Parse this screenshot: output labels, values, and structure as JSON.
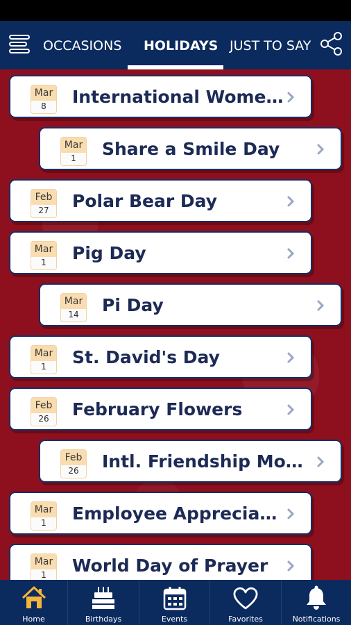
{
  "top_nav": {
    "tabs": [
      {
        "label": "OCCASIONS",
        "active": false
      },
      {
        "label": "HOLIDAYS",
        "active": true
      },
      {
        "label": "JUST TO SAY",
        "active": false
      }
    ],
    "menu_icon": "hamburger-menu-icon",
    "share_icon": "share-icon"
  },
  "holidays": [
    {
      "month": "Mar",
      "day": "8",
      "title": "International Women...",
      "level": "outer"
    },
    {
      "month": "Mar",
      "day": "1",
      "title": "Share a Smile Day",
      "level": "inner"
    },
    {
      "month": "Feb",
      "day": "27",
      "title": "Polar Bear Day",
      "level": "outer"
    },
    {
      "month": "Mar",
      "day": "1",
      "title": "Pig Day",
      "level": "outer"
    },
    {
      "month": "Mar",
      "day": "14",
      "title": "Pi Day",
      "level": "inner"
    },
    {
      "month": "Mar",
      "day": "1",
      "title": "St. David's Day",
      "level": "outer"
    },
    {
      "month": "Feb",
      "day": "26",
      "title": "February Flowers",
      "level": "outer"
    },
    {
      "month": "Feb",
      "day": "26",
      "title": "Intl. Friendship Month",
      "level": "inner"
    },
    {
      "month": "Mar",
      "day": "1",
      "title": "Employee Appreciati...",
      "level": "outer"
    },
    {
      "month": "Mar",
      "day": "1",
      "title": "World Day of Prayer",
      "level": "outer"
    }
  ],
  "bottom_nav": {
    "items": [
      {
        "label": "Home",
        "icon": "home-icon",
        "active": true
      },
      {
        "label": "Birthdays",
        "icon": "birthday-cake-icon",
        "active": false
      },
      {
        "label": "Events",
        "icon": "calendar-icon",
        "active": false
      },
      {
        "label": "Favorites",
        "icon": "heart-icon",
        "active": false
      },
      {
        "label": "Notifications",
        "icon": "bell-icon",
        "active": false
      }
    ]
  },
  "colors": {
    "nav_bg": "#0b2a5e",
    "content_bg": "#8e0f1e",
    "card_title": "#1c2a55",
    "calendar_header": "#f9dcb0",
    "home_icon_active": "#f5b53a"
  }
}
